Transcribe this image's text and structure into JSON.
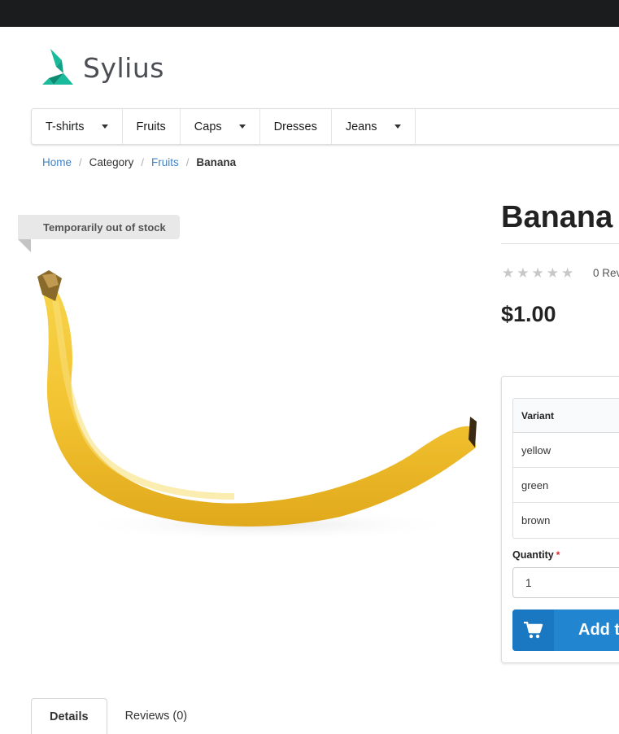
{
  "brand": {
    "name": "Sylius",
    "logo_color": "#1abb9c"
  },
  "menu": {
    "items": [
      {
        "label": "T-shirts",
        "dropdown": true
      },
      {
        "label": "Fruits",
        "dropdown": false
      },
      {
        "label": "Caps",
        "dropdown": true
      },
      {
        "label": "Dresses",
        "dropdown": false
      },
      {
        "label": "Jeans",
        "dropdown": true
      }
    ]
  },
  "breadcrumb": {
    "home": "Home",
    "category": "Category",
    "fruits": "Fruits",
    "current": "Banana",
    "divider": "/"
  },
  "product": {
    "stock_ribbon": "Temporarily out of stock",
    "title": "Banana",
    "rating": 0,
    "max_rating": 5,
    "reviews_count_text": "0 Rev",
    "price": "$1.00"
  },
  "cart": {
    "variant_header": "Variant",
    "variants": [
      "yellow",
      "green",
      "brown"
    ],
    "quantity_label": "Quantity",
    "required_mark": "*",
    "quantity_value": "1",
    "add_button_label": "Add t"
  },
  "tabs": [
    {
      "label": "Details",
      "active": true
    },
    {
      "label": "Reviews (0)",
      "active": false
    }
  ],
  "colors": {
    "top_bar": "#1b1c1d",
    "link": "#4183c4",
    "primary_button": "#2185d0",
    "required": "#db2828"
  }
}
